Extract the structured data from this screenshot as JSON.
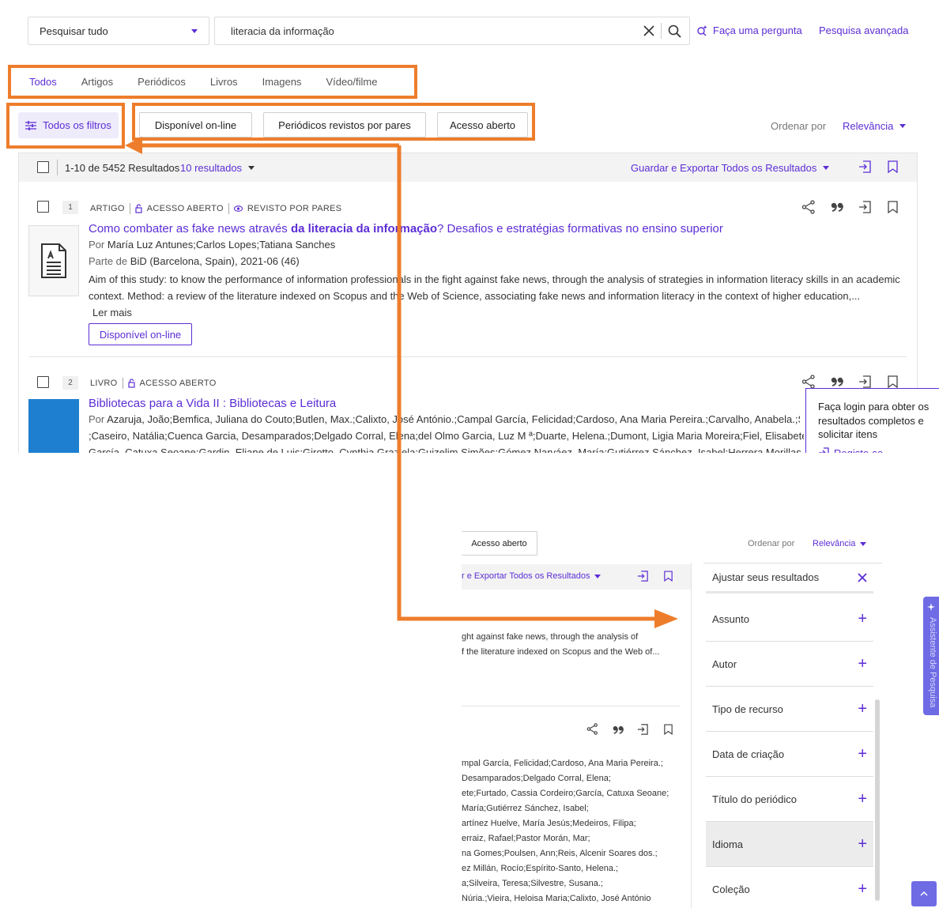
{
  "search": {
    "scope": "Pesquisar tudo",
    "query": "literacia da informação",
    "ask_link": "Faça uma pergunta",
    "advanced_link": "Pesquisa avançada"
  },
  "tabs": [
    {
      "label": "Todos",
      "active": true
    },
    {
      "label": "Artigos"
    },
    {
      "label": "Periódicos"
    },
    {
      "label": "Livros"
    },
    {
      "label": "Imagens"
    },
    {
      "label": "Vídeo/filme"
    }
  ],
  "filters": {
    "all_filters": "Todos os filtros",
    "chips": [
      "Disponível on-line",
      "Periódicos revistos por pares",
      "Acesso aberto"
    ]
  },
  "sort": {
    "label": "Ordenar por",
    "value": "Relevância"
  },
  "results_header": {
    "count": "1-10 de 5452 Resultados",
    "per_page": "10 resultados",
    "save_export": "Guardar e Exportar Todos os Resultados"
  },
  "records": [
    {
      "number": "1",
      "type": "ARTIGO",
      "open_access": "ACESSO ABERTO",
      "peer_reviewed": "REVISTO POR PARES",
      "title_pre": "Como combater as fake news através ",
      "title_bold": "da literacia da informação",
      "title_post": "? Desafios e estratégias formativas no ensino superior",
      "by_label": "Por",
      "authors": "María Luz Antunes;Carlos Lopes;Tatiana Sanches",
      "part_label": "Parte de",
      "source": "BiD (Barcelona, Spain), 2021-06 (46)",
      "abstract": "Aim of this study: to know the performance of information professionals in the fight against fake news, through the analysis of strategies in information literacy skills in an academic context. Method: a review of the literature indexed on Scopus and the Web of Science, associating fake news and information literacy in the context of higher education,...",
      "read_more": "Ler mais",
      "availability": "Disponível on-line"
    },
    {
      "number": "2",
      "type": "LIVRO",
      "open_access": "ACESSO ABERTO",
      "title": "Bibliotecas para a Vida II : Bibliotecas e Leitura",
      "by_label": "Por",
      "authors_line1": "Azaruja, João;Bemfica, Juliana do Couto;Butlen, Max.;Calixto, José António.;Campal García, Felicidad;Cardoso, Ana Maria Pereira.;Carvalho, Anabela.;Silva, Kát",
      "authors_line2": ";Caseiro, Natália;Cuenca Garcia, Desamparados;Delgado Corral, Elena;del Olmo Garcia, Luz M ª;Duarte, Helena.;Dumont, Ligia Maria Moreira;Fiel, Elisabete;Furta",
      "authors_line3": "García, Catuxa Seoane;Gardin, Eliane de Luis;Girotto, Cynthia Graziela;Guizelim Simões;Gómez Narváez, María;Gutiérrez Sánchez, Isabel;Herrera Morillas, José L"
    }
  ],
  "login_popup": {
    "text": "Faça login para obter os resultados completos e solicitar itens",
    "link": "Registe-se"
  },
  "excerpt": {
    "chip": "Acesso aberto",
    "sort_label": "Ordenar por",
    "sort_value": "Relevância",
    "save_export": "r e Exportar Todos os Resultados",
    "abstract_line1": "ght against fake news, through the analysis of",
    "abstract_line2": "f the literature indexed on Scopus and the Web of...",
    "authors_lines": [
      "mpal García, Felicidad;Cardoso, Ana Maria Pereira.;",
      "Desamparados;Delgado Corral, Elena;",
      "ete;Furtado, Cassia Cordeiro;García, Catuxa Seoane;",
      "María;Gutiérrez Sánchez, Isabel;",
      "artínez Huelve, María Jesús;Medeiros, Filipa;",
      "erraiz, Rafael;Pastor Morán, Mar;",
      "na Gomes;Poulsen, Ann;Reis, Alcenir Soares dos.;",
      "ez Millán, Rocío;Espírito-Santo, Helena.;",
      "a;Silveira, Teresa;Silvestre, Susana.;",
      "Núria.;Vieira, Heloisa Maria;Calixto, José António"
    ]
  },
  "facets": {
    "title": "Ajustar seus resultados",
    "items": [
      "Assunto",
      "Autor",
      "Tipo de recurso",
      "Data de criação",
      "Título do periódico",
      "Idioma",
      "Coleção"
    ]
  },
  "assistant": {
    "label": "Assistente de Pesquisa"
  },
  "colors": {
    "accent": "#5c2dd5",
    "annotation": "#ee7d2b",
    "assistant": "#6e6be5"
  }
}
